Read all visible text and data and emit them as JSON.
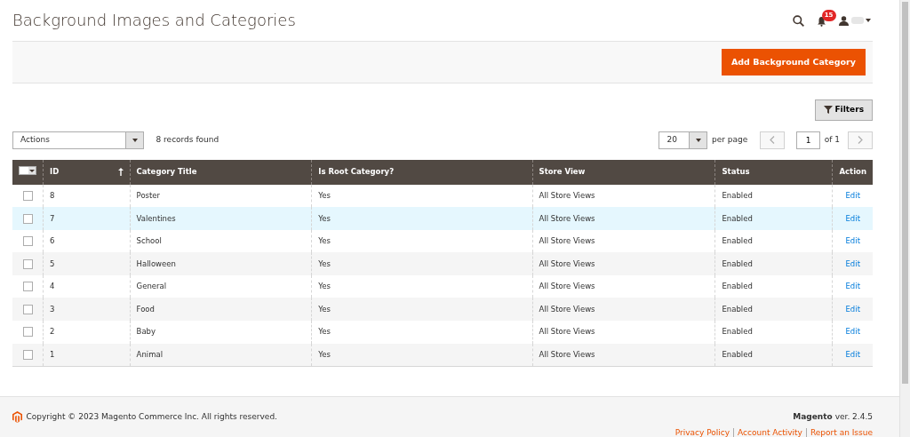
{
  "page_title": "Background Images and Categories",
  "header": {
    "notification_count": "15"
  },
  "add_button": "Add Background Category",
  "filters_button": "Filters",
  "actions_select": "Actions",
  "records_found": "8 records found",
  "pager": {
    "per_page_value": "20",
    "per_page_label": "per page",
    "page": "1",
    "of_pages": "of 1"
  },
  "table": {
    "select_all_checked": false,
    "columns": [
      "ID",
      "Category Title",
      "Is Root Category?",
      "Store View",
      "Status",
      "Action"
    ],
    "rows": [
      {
        "id": "8",
        "title": "Poster",
        "root": "Yes",
        "store": "All Store Views",
        "status": "Enabled",
        "action": "Edit",
        "checked": false,
        "hovered": false
      },
      {
        "id": "7",
        "title": "Valentines",
        "root": "Yes",
        "store": "All Store Views",
        "status": "Enabled",
        "action": "Edit",
        "checked": false,
        "hovered": true
      },
      {
        "id": "6",
        "title": "School",
        "root": "Yes",
        "store": "All Store Views",
        "status": "Enabled",
        "action": "Edit",
        "checked": false,
        "hovered": false
      },
      {
        "id": "5",
        "title": "Halloween",
        "root": "Yes",
        "store": "All Store Views",
        "status": "Enabled",
        "action": "Edit",
        "checked": false,
        "hovered": false
      },
      {
        "id": "4",
        "title": "General",
        "root": "Yes",
        "store": "All Store Views",
        "status": "Enabled",
        "action": "Edit",
        "checked": false,
        "hovered": false
      },
      {
        "id": "3",
        "title": "Food",
        "root": "Yes",
        "store": "All Store Views",
        "status": "Enabled",
        "action": "Edit",
        "checked": false,
        "hovered": false
      },
      {
        "id": "2",
        "title": "Baby",
        "root": "Yes",
        "store": "All Store Views",
        "status": "Enabled",
        "action": "Edit",
        "checked": false,
        "hovered": false
      },
      {
        "id": "1",
        "title": "Animal",
        "root": "Yes",
        "store": "All Store Views",
        "status": "Enabled",
        "action": "Edit",
        "checked": false,
        "hovered": false
      }
    ]
  },
  "footer": {
    "copyright": "Copyright © 2023 Magento Commerce Inc. All rights reserved.",
    "brand": "Magento",
    "version": "ver. 2.4.5",
    "links": [
      "Privacy Policy",
      "Account Activity",
      "Report an Issue"
    ]
  }
}
